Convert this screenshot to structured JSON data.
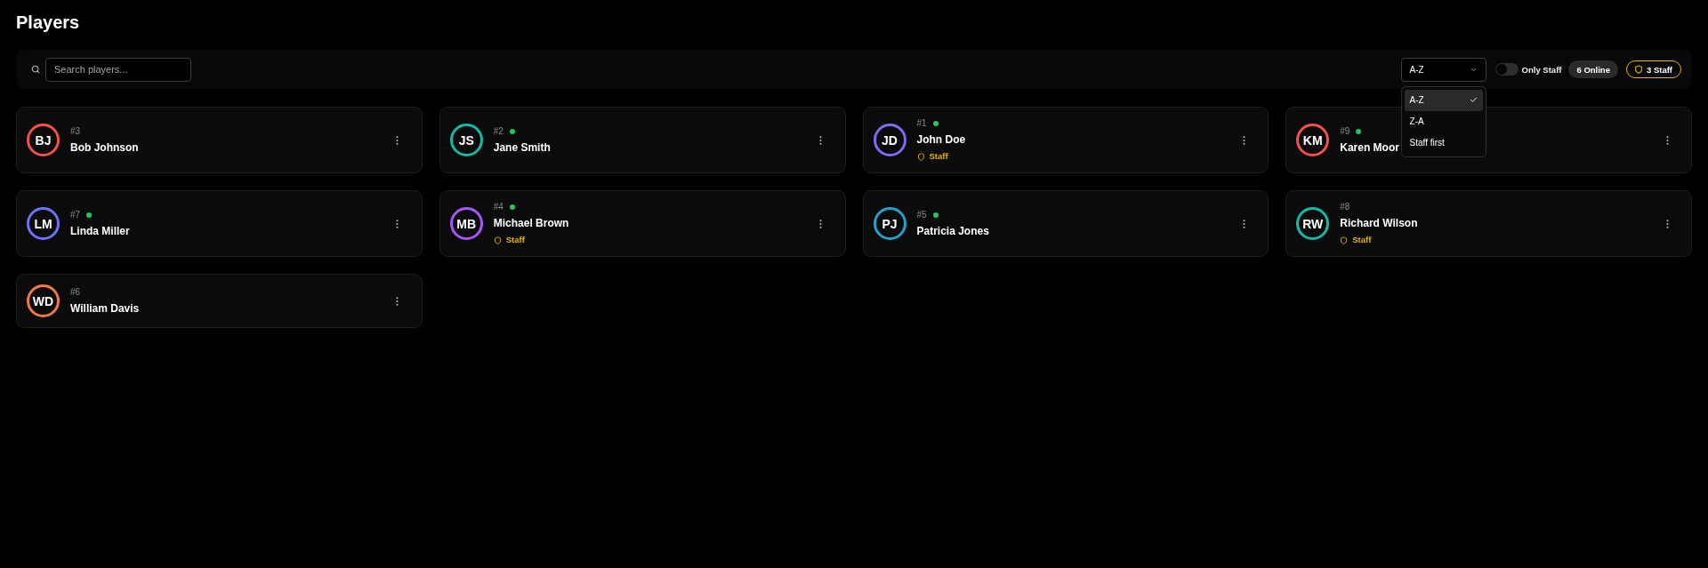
{
  "title": "Players",
  "toolbar": {
    "search": {
      "placeholder": "Search players..."
    },
    "sort": {
      "value": "A-Z",
      "expanded": true,
      "options": [
        {
          "label": "A-Z",
          "selected": true
        },
        {
          "label": "Z-A",
          "selected": false
        },
        {
          "label": "Staff first",
          "selected": false
        }
      ]
    },
    "staff_filter": {
      "label": "Only Staff",
      "on": false
    },
    "online_count": "6 Online",
    "staff_count": "3 Staff"
  },
  "players": [
    {
      "initials": "BJ",
      "number": "#3",
      "name": "Bob Johnson",
      "online": false,
      "color": "#f0524a"
    },
    {
      "initials": "JS",
      "number": "#2",
      "name": "Jane Smith",
      "online": true,
      "color": "#14b8a6"
    },
    {
      "initials": "JD",
      "number": "#1",
      "name": "John Doe",
      "online": true,
      "badge": "Staff",
      "color": "#7c6cf2"
    },
    {
      "initials": "KM",
      "number": "#9",
      "name": "Karen Moor",
      "online": true,
      "color": "#f0524a"
    },
    {
      "initials": "LM",
      "number": "#7",
      "name": "Linda Miller",
      "online": true,
      "color": "#6d72f5"
    },
    {
      "initials": "MB",
      "number": "#4",
      "name": "Michael Brown",
      "online": true,
      "badge": "Staff",
      "color": "#a855f7"
    },
    {
      "initials": "PJ",
      "number": "#5",
      "name": "Patricia Jones",
      "online": true,
      "color": "#22a2c8"
    },
    {
      "initials": "RW",
      "number": "#8",
      "name": "Richard Wilson",
      "online": false,
      "badge": "Staff",
      "color": "#14b8a6"
    },
    {
      "initials": "WD",
      "number": "#6",
      "name": "William Davis",
      "online": false,
      "color": "#f2784a"
    }
  ]
}
